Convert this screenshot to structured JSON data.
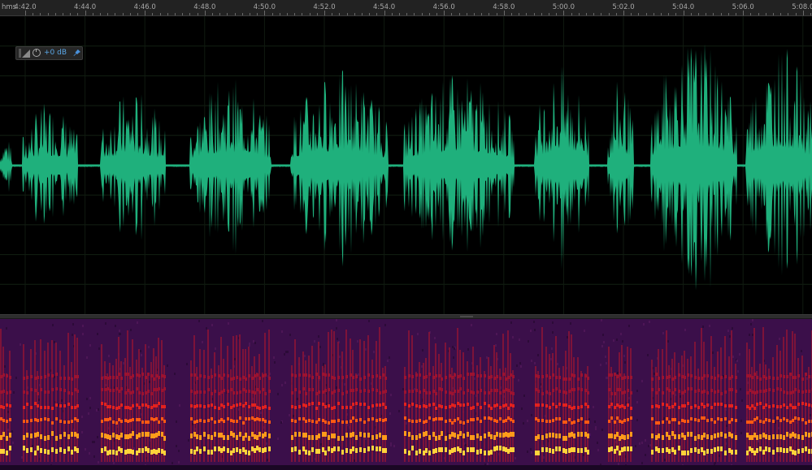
{
  "ruler": {
    "unit_label": "hms",
    "ticks": [
      "4:42.0",
      "4:44.0",
      "4:46.0",
      "4:48.0",
      "4:50.0",
      "4:52.0",
      "4:54.0",
      "4:56.0",
      "4:58.0",
      "5:00.0",
      "5:02.0",
      "5:04.0",
      "5:06.0",
      "5:08.0"
    ]
  },
  "hud": {
    "volume_value": "+0 dB",
    "icons": [
      "level-meter-icon",
      "volume-knob-icon",
      "pin-icon"
    ]
  },
  "colors": {
    "waveform": "#1fb07c",
    "spectral_background": "#3b0f4a",
    "ruler_background": "#222222"
  }
}
